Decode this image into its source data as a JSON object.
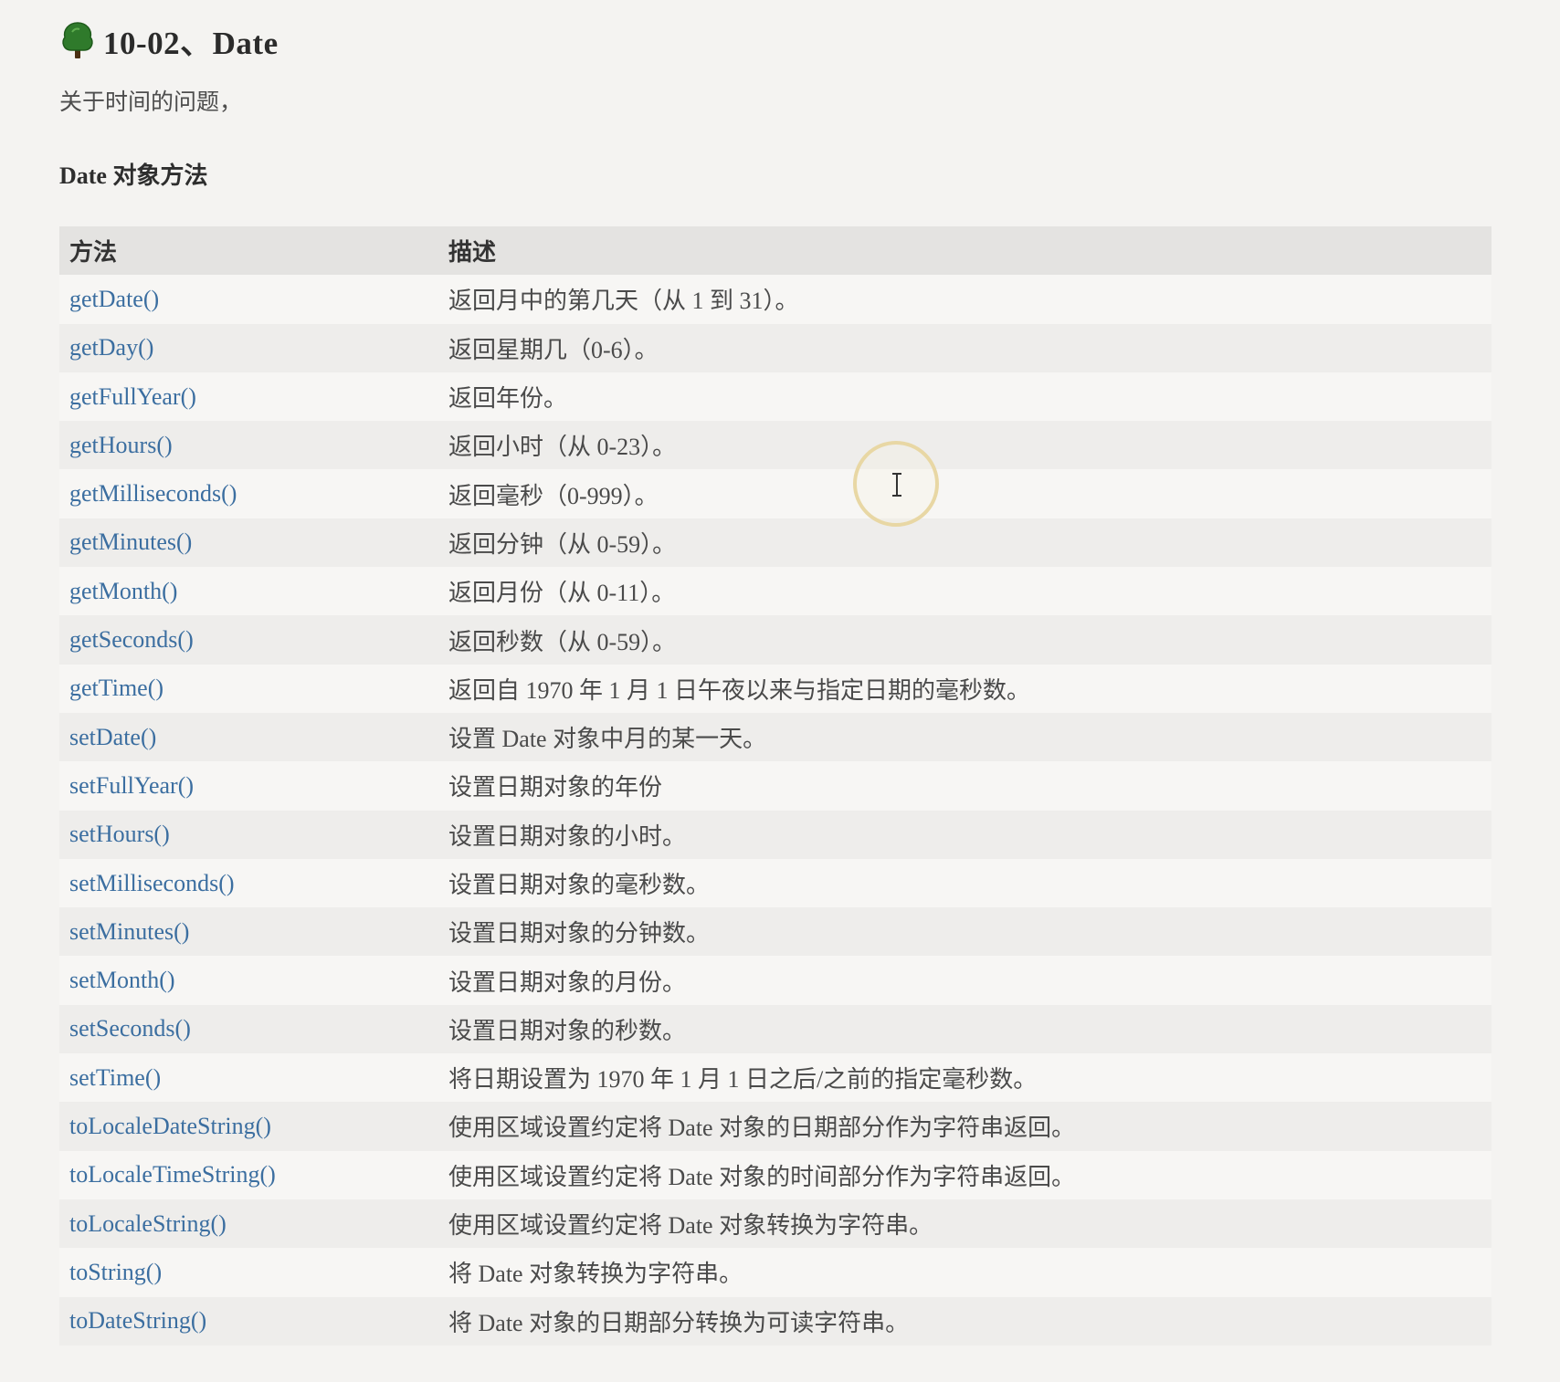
{
  "header": {
    "icon": "tree-icon",
    "title": "10-02、Date"
  },
  "intro": "关于时间的问题，",
  "section_title": "Date 对象方法",
  "table": {
    "columns": [
      "方法",
      "描述"
    ],
    "rows": [
      {
        "method": "getDate()",
        "desc": "返回月中的第几天（从 1 到 31）。"
      },
      {
        "method": "getDay()",
        "desc": "返回星期几（0-6）。"
      },
      {
        "method": "getFullYear()",
        "desc": "返回年份。"
      },
      {
        "method": "getHours()",
        "desc": "返回小时（从 0-23）。"
      },
      {
        "method": "getMilliseconds()",
        "desc": "返回毫秒（0-999）。"
      },
      {
        "method": "getMinutes()",
        "desc": "返回分钟（从 0-59）。"
      },
      {
        "method": "getMonth()",
        "desc": "返回月份（从 0-11）。"
      },
      {
        "method": "getSeconds()",
        "desc": "返回秒数（从 0-59）。"
      },
      {
        "method": "getTime()",
        "desc": "返回自 1970 年 1 月 1 日午夜以来与指定日期的毫秒数。"
      },
      {
        "method": "setDate()",
        "desc": "设置 Date 对象中月的某一天。"
      },
      {
        "method": "setFullYear()",
        "desc": "设置日期对象的年份"
      },
      {
        "method": "setHours()",
        "desc": "设置日期对象的小时。"
      },
      {
        "method": "setMilliseconds()",
        "desc": "设置日期对象的毫秒数。"
      },
      {
        "method": "setMinutes()",
        "desc": "设置日期对象的分钟数。"
      },
      {
        "method": "setMonth()",
        "desc": "设置日期对象的月份。"
      },
      {
        "method": "setSeconds()",
        "desc": "设置日期对象的秒数。"
      },
      {
        "method": "setTime()",
        "desc": "将日期设置为 1970 年 1 月 1 日之后/之前的指定毫秒数。"
      },
      {
        "method": "toLocaleDateString()",
        "desc": "使用区域设置约定将 Date 对象的日期部分作为字符串返回。"
      },
      {
        "method": "toLocaleTimeString()",
        "desc": "使用区域设置约定将 Date 对象的时间部分作为字符串返回。"
      },
      {
        "method": "toLocaleString()",
        "desc": "使用区域设置约定将 Date 对象转换为字符串。"
      },
      {
        "method": "toString()",
        "desc": "将 Date 对象转换为字符串。"
      },
      {
        "method": "toDateString()",
        "desc": "将 Date 对象的日期部分转换为可读字符串。"
      }
    ]
  },
  "colors": {
    "link": "#3b6ea0",
    "header_row_bg": "#e4e3e1",
    "stripe_bg": "#eeedeb",
    "page_bg": "#f4f3f1",
    "icon_green": "#2f7a2b"
  },
  "cursor": {
    "icon": "text-cursor-icon"
  }
}
